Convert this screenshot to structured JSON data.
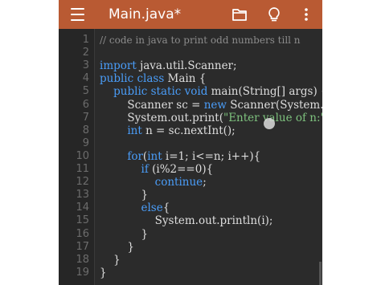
{
  "app": {
    "title": "Main.java*",
    "accent": "#b95a33"
  },
  "toolbar": {
    "menu_icon": "hamburger-menu-icon",
    "open_icon": "folder-icon",
    "hint_icon": "lightbulb-icon",
    "more_icon": "more-vert-icon"
  },
  "editor": {
    "lines": [
      {
        "n": "1",
        "tokens": [
          {
            "t": "// code in java to print odd numbers till n",
            "c": "comment"
          }
        ]
      },
      {
        "n": "2",
        "tokens": []
      },
      {
        "n": "3",
        "tokens": [
          {
            "t": "import",
            "c": "keyword"
          },
          {
            "t": " java.util.Scanner;",
            "c": "plain"
          }
        ]
      },
      {
        "n": "4",
        "tokens": [
          {
            "t": "public class",
            "c": "keyword"
          },
          {
            "t": " Main {",
            "c": "plain"
          }
        ]
      },
      {
        "n": "5",
        "tokens": [
          {
            "t": "    public static void",
            "c": "keyword"
          },
          {
            "t": " main(String[] args) {",
            "c": "plain"
          }
        ]
      },
      {
        "n": "6",
        "tokens": [
          {
            "t": "        Scanner sc = ",
            "c": "plain"
          },
          {
            "t": "new",
            "c": "keyword"
          },
          {
            "t": " Scanner(System.in);",
            "c": "plain"
          }
        ]
      },
      {
        "n": "7",
        "tokens": [
          {
            "t": "        System.out.print(",
            "c": "plain"
          },
          {
            "t": "\"Enter value of n:\"",
            "c": "string"
          },
          {
            "t": ");",
            "c": "plain"
          }
        ]
      },
      {
        "n": "8",
        "tokens": [
          {
            "t": "        ",
            "c": "plain"
          },
          {
            "t": "int",
            "c": "keyword"
          },
          {
            "t": " n = sc.nextInt();",
            "c": "plain"
          }
        ]
      },
      {
        "n": "9",
        "tokens": []
      },
      {
        "n": "10",
        "tokens": [
          {
            "t": "        ",
            "c": "plain"
          },
          {
            "t": "for",
            "c": "keyword"
          },
          {
            "t": "(",
            "c": "plain"
          },
          {
            "t": "int",
            "c": "keyword"
          },
          {
            "t": " i=1; i<=n; i++){",
            "c": "plain"
          }
        ]
      },
      {
        "n": "11",
        "tokens": [
          {
            "t": "            ",
            "c": "plain"
          },
          {
            "t": "if",
            "c": "keyword"
          },
          {
            "t": " (i%2==0){",
            "c": "plain"
          }
        ]
      },
      {
        "n": "12",
        "tokens": [
          {
            "t": "                ",
            "c": "plain"
          },
          {
            "t": "continue",
            "c": "keyword"
          },
          {
            "t": ";",
            "c": "plain"
          }
        ]
      },
      {
        "n": "13",
        "tokens": [
          {
            "t": "            }",
            "c": "plain"
          }
        ]
      },
      {
        "n": "14",
        "tokens": [
          {
            "t": "            ",
            "c": "plain"
          },
          {
            "t": "else",
            "c": "keyword"
          },
          {
            "t": "{",
            "c": "plain"
          }
        ]
      },
      {
        "n": "15",
        "tokens": [
          {
            "t": "                System.out.println(i);",
            "c": "plain"
          }
        ]
      },
      {
        "n": "16",
        "tokens": [
          {
            "t": "            }",
            "c": "plain"
          }
        ]
      },
      {
        "n": "17",
        "tokens": [
          {
            "t": "        }",
            "c": "plain"
          }
        ]
      },
      {
        "n": "18",
        "tokens": [
          {
            "t": "    }",
            "c": "plain"
          }
        ]
      },
      {
        "n": "19",
        "tokens": [
          {
            "t": "}",
            "c": "plain"
          }
        ]
      }
    ]
  }
}
